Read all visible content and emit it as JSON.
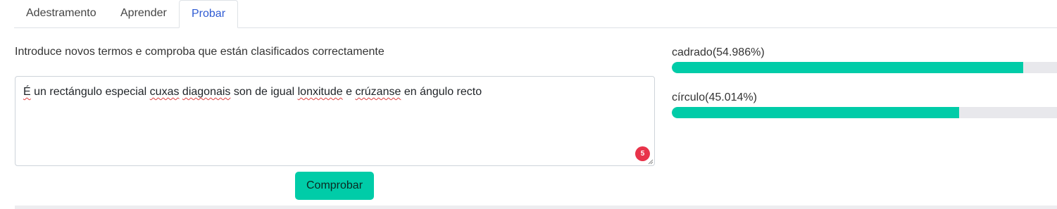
{
  "tabs": [
    {
      "label": "Adestramento",
      "active": false
    },
    {
      "label": "Aprender",
      "active": false
    },
    {
      "label": "Probar",
      "active": true
    }
  ],
  "instruction": "Introduce novos termos e comproba que están clasificados correctamente",
  "input": {
    "segments": [
      {
        "text": "É",
        "flagged": true
      },
      {
        "text": " un rectángulo especial ",
        "flagged": false
      },
      {
        "text": "cuxas",
        "flagged": true
      },
      {
        "text": " ",
        "flagged": false
      },
      {
        "text": "diagonais",
        "flagged": true
      },
      {
        "text": " son de igual ",
        "flagged": false
      },
      {
        "text": "lonxitude",
        "flagged": true
      },
      {
        "text": " e ",
        "flagged": false
      },
      {
        "text": "crúzanse",
        "flagged": true
      },
      {
        "text": " en ángulo recto",
        "flagged": false
      }
    ],
    "issue_count": "5"
  },
  "check_button": {
    "label": "Comprobar"
  },
  "results": [
    {
      "label": "cadrado(54.986%)",
      "value": 0.912
    },
    {
      "label": "círculo(45.014%)",
      "value": 0.746
    }
  ],
  "colors": {
    "accent": "#00cca8",
    "active_tab": "#2f5bd3",
    "badge": "#e8334a",
    "track": "#e8e8ec"
  },
  "icons": {
    "issue_badge": "grammar-issues-icon",
    "resize": "resize-grip-icon"
  }
}
